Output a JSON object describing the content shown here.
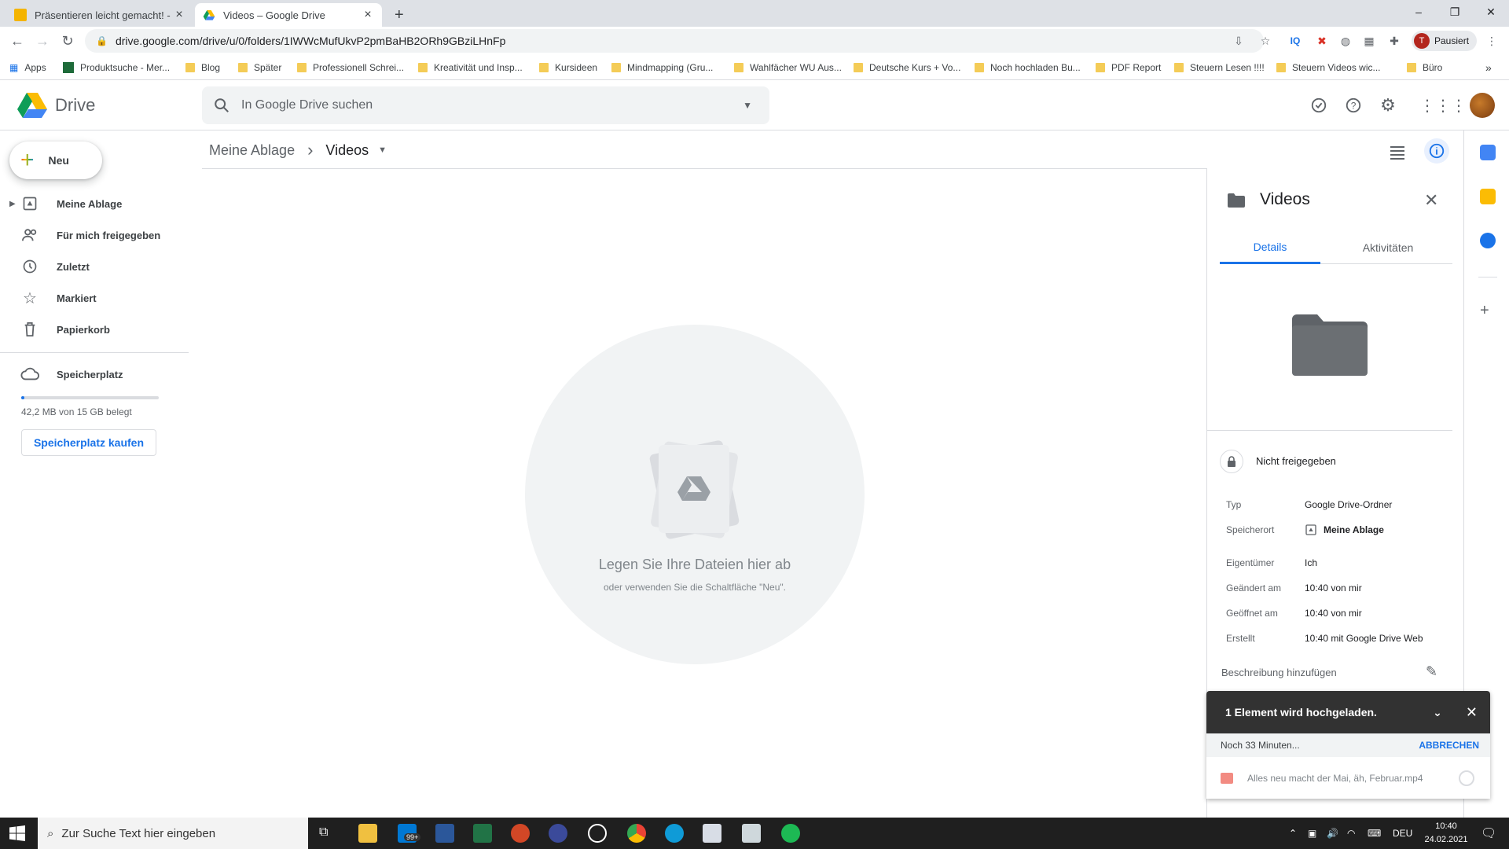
{
  "browser": {
    "tabs": [
      {
        "title": "Präsentieren leicht gemacht! - G",
        "active": false
      },
      {
        "title": "Videos – Google Drive",
        "active": true
      }
    ],
    "new_tab": "+",
    "window": {
      "minimize": "–",
      "restore": "❐",
      "close": "✕"
    },
    "url": "drive.google.com/drive/u/0/folders/1IWWcMufUkvP2pmBaHB2ORh9GBziLHnFp",
    "profile": {
      "initial": "T",
      "label": "Pausiert"
    },
    "bookmarks": [
      "Apps",
      "Produktsuche - Mer...",
      "Blog",
      "Später",
      "Professionell Schrei...",
      "Kreativität und Insp...",
      "Kursideen",
      "Mindmapping  (Gru...",
      "Wahlfächer WU Aus...",
      "Deutsche Kurs + Vo...",
      "Noch hochladen Bu...",
      "PDF Report",
      "Steuern Lesen !!!!",
      "Steuern Videos wic...",
      "Büro"
    ],
    "bookmarks_more": "»"
  },
  "drive": {
    "logo_text": "Drive",
    "search_placeholder": "In Google Drive suchen",
    "new_label": "Neu",
    "nav": [
      {
        "label": "Meine Ablage",
        "icon": "my-drive-icon"
      },
      {
        "label": "Für mich freigegeben",
        "icon": "shared-icon"
      },
      {
        "label": "Zuletzt",
        "icon": "clock-icon"
      },
      {
        "label": "Markiert",
        "icon": "star-icon"
      },
      {
        "label": "Papierkorb",
        "icon": "trash-icon"
      }
    ],
    "storage": {
      "label": "Speicherplatz",
      "used_text": "42,2 MB von 15 GB belegt",
      "used_fraction": 0.003,
      "buy_label": "Speicherplatz kaufen"
    },
    "breadcrumb": {
      "parent": "Meine Ablage",
      "separator": "›",
      "current": "Videos"
    },
    "drop": {
      "title": "Legen Sie Ihre Dateien hier ab",
      "subtitle": "oder verwenden Sie die Schaltfläche \"Neu\"."
    },
    "details": {
      "title": "Videos",
      "tabs": [
        "Details",
        "Aktivitäten"
      ],
      "sharing": "Nicht freigegeben",
      "props": [
        {
          "label": "Typ",
          "value": "Google Drive-Ordner"
        },
        {
          "label": "Speicherort",
          "value": "Meine Ablage"
        },
        {
          "label": "Eigentümer",
          "value": "Ich"
        },
        {
          "label": "Geändert am",
          "value": "10:40 von mir"
        },
        {
          "label": "Geöffnet am",
          "value": "10:40 von mir"
        },
        {
          "label": "Erstellt",
          "value": "10:40 mit Google Drive Web"
        }
      ],
      "description_label": "Beschreibung hinzufügen"
    },
    "upload": {
      "title": "1 Element wird hochgeladen.",
      "remaining": "Noch 33 Minuten...",
      "cancel": "ABBRECHEN",
      "file": "Alles neu macht der Mai, äh, Februar.mp4"
    }
  },
  "taskbar": {
    "search_placeholder": "Zur Suche Text hier eingeben",
    "mail_badge": "99+",
    "lang": "DEU",
    "time": "10:40",
    "date": "24.02.2021"
  },
  "colors": {
    "accent": "#1a73e8",
    "folder": "#5f6368"
  }
}
